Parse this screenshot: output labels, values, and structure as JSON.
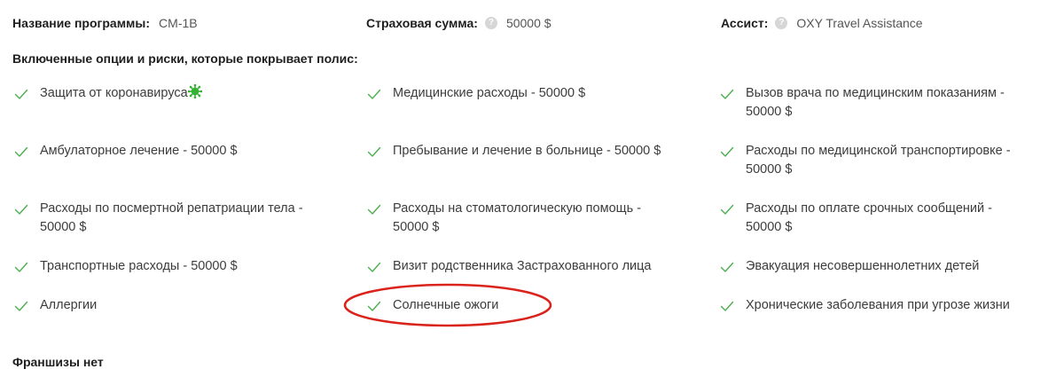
{
  "header": {
    "program": {
      "label": "Название программы:",
      "value": "CM-1B"
    },
    "sum": {
      "label": "Страховая сумма:",
      "value": "50000 $"
    },
    "assist": {
      "label": "Ассист:",
      "value": "OXY Travel Assistance"
    },
    "help_glyph": "?"
  },
  "section_title": "Включенные опции и риски, которые покрывает полис:",
  "options": [
    "Защита от коронавируса",
    "Медицинские расходы - 50000 $",
    "Вызов врача по медицинским показаниям -\n50000 $",
    "Амбулаторное лечение - 50000 $",
    "Пребывание и лечение в больнице - 50000 $",
    "Расходы по медицинской транспортировке -\n50000 $",
    "Расходы по посмертной репатриации тела -\n50000 $",
    "Расходы на стоматологическую помощь -\n50000 $",
    "Расходы по оплате срочных сообщений -\n50000 $",
    "Транспортные расходы - 50000 $",
    "Визит родственника Застрахованного лица",
    "Эвакуация несовершеннолетних детей",
    "Аллергии",
    "Солнечные ожоги",
    "Хронические заболевания при угрозе жизни"
  ],
  "franchise": "Франшизы нет",
  "colors": {
    "check": "#4caf50",
    "virus": "#34b233",
    "highlight": "#d9231b",
    "help_bg": "#d6d6d6"
  },
  "icons": {
    "check": "check-icon",
    "virus": "virus-icon",
    "help": "help-icon"
  }
}
